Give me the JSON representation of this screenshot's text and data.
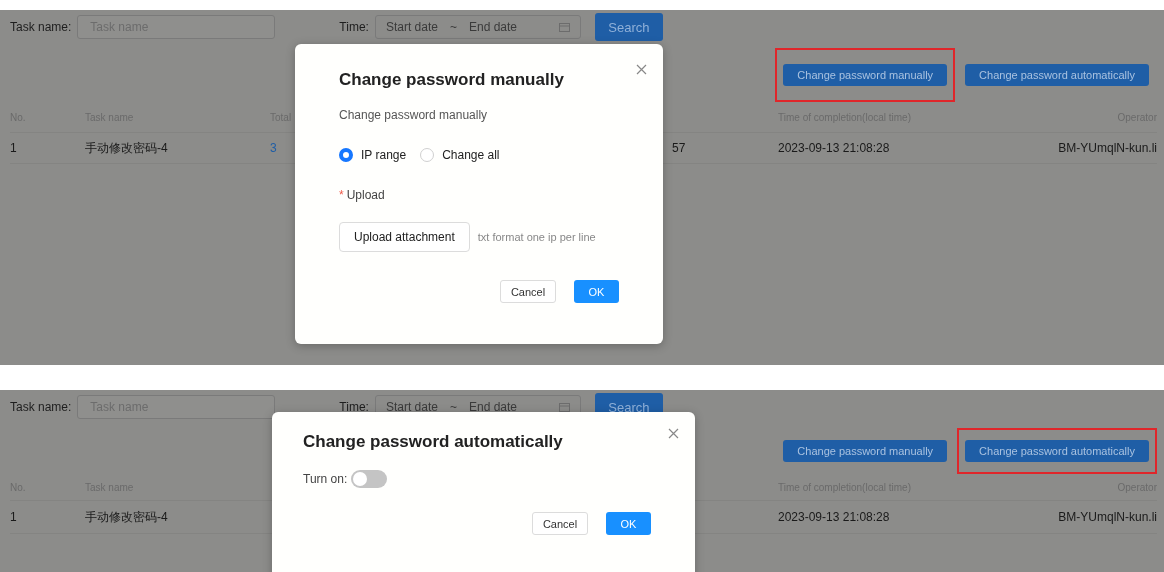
{
  "panels": [
    {
      "filter": {
        "task_label": "Task name:",
        "task_placeholder": "Task name",
        "time_label": "Time:",
        "start_placeholder": "Start date",
        "separator": "~",
        "end_placeholder": "End date",
        "search_button": "Search"
      },
      "actions": [
        {
          "label": "Change password manually",
          "highlighted": true
        },
        {
          "label": "Change password automatically",
          "highlighted": false
        }
      ],
      "header": {
        "no": "No.",
        "task_name": "Task name",
        "total": "Total",
        "completion": "Time of completion(local time)",
        "operator": "Operator"
      },
      "row": {
        "no": "1",
        "task_name": "手动修改密码-4",
        "total": "3",
        "end": "57",
        "completion": "2023-09-13 21:08:28",
        "operator": "BM-YUmqlN-kun.li"
      },
      "dialog": {
        "kind": "manual",
        "title": "Change password manually",
        "subtitle": "Change password manually",
        "options": [
          {
            "label": "IP range",
            "selected": true
          },
          {
            "label": "Change all",
            "selected": false
          }
        ],
        "upload_label": "Upload",
        "required_mark": "*",
        "upload_button": "Upload attachment",
        "upload_hint": "txt format one ip per line",
        "cancel": "Cancel",
        "ok": "OK"
      }
    },
    {
      "filter": {
        "task_label": "Task name:",
        "task_placeholder": "Task name",
        "time_label": "Time:",
        "start_placeholder": "Start date",
        "separator": "~",
        "end_placeholder": "End date",
        "search_button": "Search"
      },
      "actions": [
        {
          "label": "Change password manually",
          "highlighted": false
        },
        {
          "label": "Change password automatically",
          "highlighted": true
        }
      ],
      "header": {
        "no": "No.",
        "task_name": "Task name",
        "completion": "Time of completion(local time)",
        "operator": "Operator"
      },
      "row": {
        "no": "1",
        "task_name": "手动修改密码-4",
        "completion": "2023-09-13 21:08:28",
        "operator": "BM-YUmqlN-kun.li"
      },
      "dialog": {
        "kind": "auto",
        "title": "Change password automatically",
        "toggle_label": "Turn on:",
        "on": false,
        "cancel": "Cancel",
        "ok": "OK"
      }
    }
  ]
}
